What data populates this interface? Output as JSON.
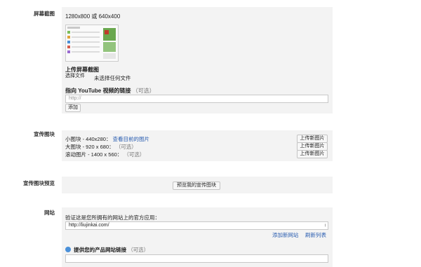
{
  "screenshots": {
    "label": "屏幕截图",
    "sizes": "1280x800 或 640x400",
    "upload_title": "上传屏幕截图",
    "choose_file": "选择文件",
    "no_file": "未选择任何文件",
    "youtube_label": "指向 YouTube 视频的链接",
    "optional": "（可选）",
    "url_placeholder": "http://",
    "add_button": "添加"
  },
  "promo_tiles": {
    "label": "宣传图块",
    "small": "小图块 - 440x280：",
    "view_current": "查看目前的图片",
    "large": "大图块 - 920 x 680：",
    "marquee": "滚动图片 - 1400 x 560：",
    "optional": "（可选）",
    "upload_button": "上传新图片"
  },
  "promo_preview": {
    "label": "宣传图块预览",
    "preview_button": "预览我的宣传图块"
  },
  "website": {
    "label": "网站",
    "verify_text": "验证这是您所拥有的网站上的官方应用：",
    "selected_site": "http://liujinkai.com/",
    "add_site": "添加新网站",
    "refresh_list": "刷新列表",
    "product_link_label": "提供您的产品网站链接",
    "optional": "（可选）"
  }
}
